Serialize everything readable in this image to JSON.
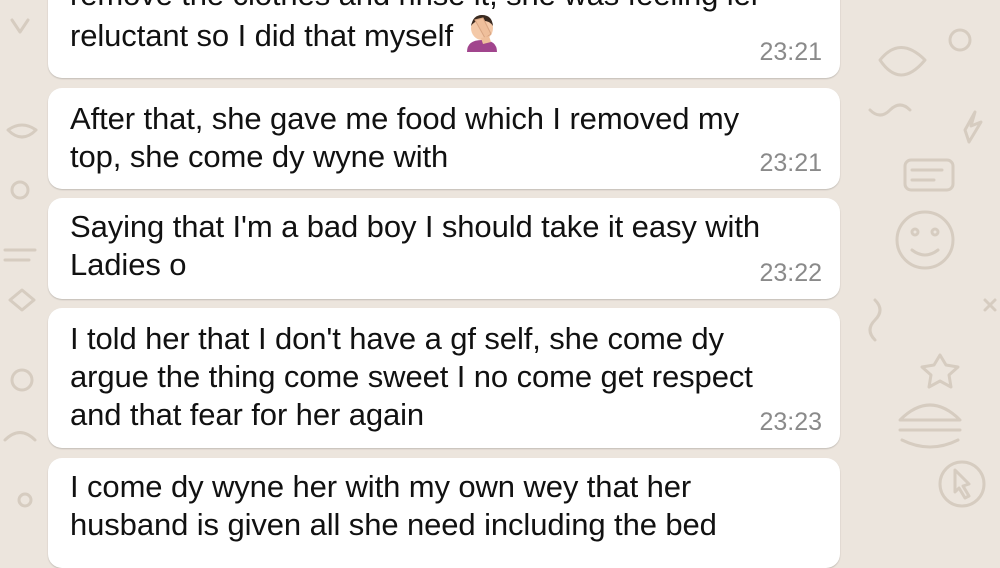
{
  "messages": [
    {
      "lines": [
        "remove the clothes and rinse it, she was feeling ler",
        "reluctant so I did that myself"
      ],
      "emoji": "face-palm-emoji",
      "time": "23:21"
    },
    {
      "lines": [
        "After that, she gave me food which I removed my",
        "top, she come dy wyne with"
      ],
      "time": "23:21"
    },
    {
      "lines": [
        "Saying that I'm a bad boy I should take it easy with",
        "Ladies o"
      ],
      "time": "23:22"
    },
    {
      "lines": [
        "I told her that I don't have a gf self, she come dy",
        "argue the thing come sweet I no come get respect",
        "and that fear for her again"
      ],
      "time": "23:23"
    },
    {
      "lines": [
        "I come dy wyne her with my own wey that her",
        "husband is given all she need including the bed"
      ],
      "time": ""
    }
  ],
  "colors": {
    "wallpaper": "#ece5dd",
    "bubble": "#ffffff",
    "text": "#111111",
    "timestamp": "#8a8a8a",
    "doodle": "#d8cfc4"
  },
  "icons": [
    "face-palm-emoji",
    "doodle-wallpaper"
  ]
}
